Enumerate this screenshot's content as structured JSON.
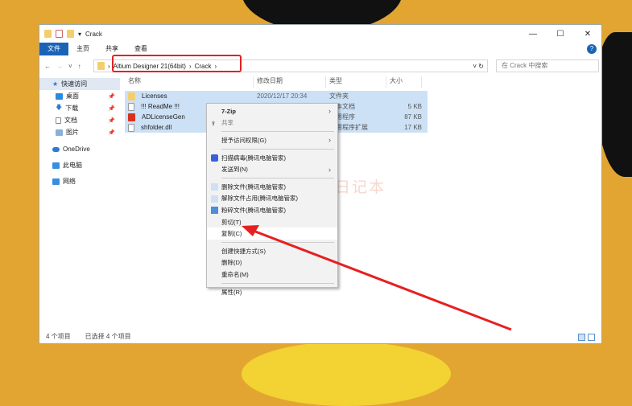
{
  "window": {
    "title": "Crack",
    "min": "—",
    "max": "☐",
    "close": "✕"
  },
  "ribbon": {
    "tabs": [
      "文件",
      "主页",
      "共享",
      "查看"
    ],
    "help": "?"
  },
  "address": {
    "crumbs": [
      "Altium Designer 21(64bit)",
      "Crack"
    ],
    "search_placeholder": "在 Crack 中搜索",
    "sep": "›"
  },
  "sidebar": [
    {
      "label": "快速访问"
    },
    {
      "label": "桌面"
    },
    {
      "label": "下载"
    },
    {
      "label": "文档"
    },
    {
      "label": "图片"
    },
    {
      "label": "OneDrive"
    },
    {
      "label": "此电脑"
    },
    {
      "label": "网络"
    }
  ],
  "columns": [
    "名称",
    "修改日期",
    "类型",
    "大小"
  ],
  "files": [
    {
      "name": "Licenses",
      "date": "2020/12/17 20:34",
      "type": "文件夹",
      "size": ""
    },
    {
      "name": "!!! ReadMe !!!",
      "date": "",
      "type": "文本文档",
      "size": "5 KB"
    },
    {
      "name": "ADLicenseGen",
      "date": "",
      "type": "应用程序",
      "size": "87 KB"
    },
    {
      "name": "shfolder.dll",
      "date": "",
      "type": "应用程序扩展",
      "size": "17 KB"
    }
  ],
  "menu": {
    "items": [
      "7-Zip",
      "共享",
      "授予访问权限(G)",
      "扫描病毒(腾讯电脑管家)",
      "发送到(N)",
      "删除文件(腾讯电脑管家)",
      "解除文件占用(腾讯电脑管家)",
      "粉碎文件(腾讯电脑管家)",
      "剪切(T)",
      "复制(C)",
      "创建快捷方式(S)",
      "删除(D)",
      "重命名(M)",
      "属性(R)"
    ]
  },
  "status": {
    "count": "4 个项目",
    "selected": "已选择 4 个项目"
  },
  "watermark": "同学日记本",
  "colors": {
    "accent": "#1a64b8",
    "annotation": "#e62020",
    "background": "#e3a532"
  }
}
